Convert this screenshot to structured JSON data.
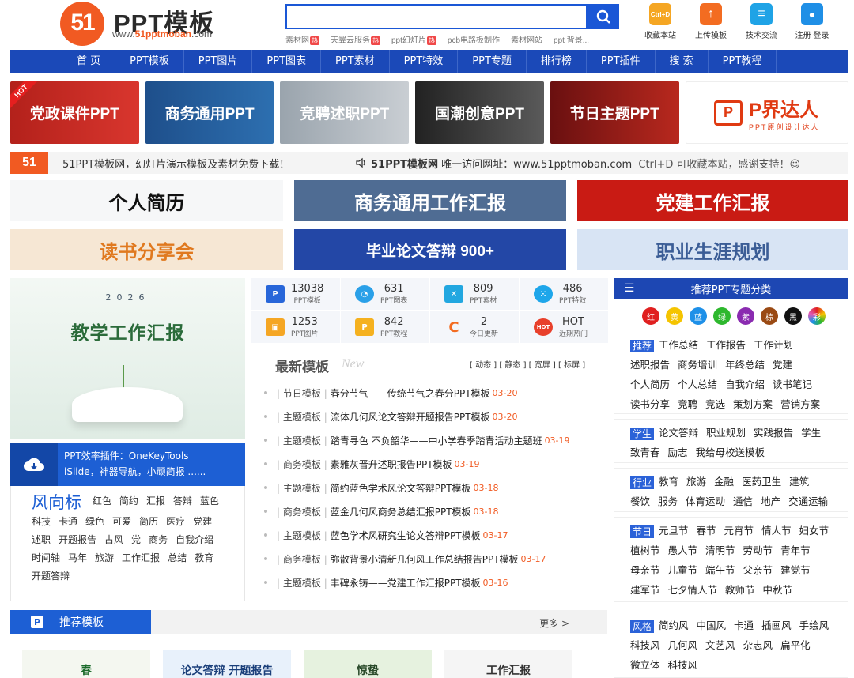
{
  "header": {
    "logo_mark": "51",
    "logo_title": "PPT模板",
    "logo_url_pre": "www.",
    "logo_url_mid": "51pptmoban",
    "logo_url_post": ".com",
    "search_placeholder": "",
    "hotwords": [
      "素材网",
      "天翼云服务",
      "ppt幻灯片",
      "pcb电路板制作",
      "素材网站",
      "ppt 背景..."
    ],
    "tools": [
      {
        "label": "收藏本站",
        "icon": "bookmark-icon",
        "color": "#f5a623",
        "glyph": "Ctrl+D"
      },
      {
        "label": "上传模板",
        "icon": "upload-icon",
        "color": "#f36c21",
        "glyph": "↑"
      },
      {
        "label": "技术交流",
        "icon": "chat-icon",
        "color": "#1fa3e6",
        "glyph": "≡"
      },
      {
        "label": "注册 登录",
        "icon": "user-icon",
        "color": "#1f8fe6",
        "glyph": "●"
      }
    ]
  },
  "nav": [
    "首 页",
    "PPT模板",
    "PPT图片",
    "PPT图表",
    "PPT素材",
    "PPT特效",
    "PPT专题",
    "排行榜",
    "PPT插件",
    "搜 索",
    "PPT教程"
  ],
  "banners": [
    "党政课件PPT",
    "商务通用PPT",
    "竞聘述职PPT",
    "国潮创意PPT",
    "节日主题PPT",
    "P界达人"
  ],
  "banner_hot": "HOT",
  "banner_sub": "PPT原创设计达人",
  "notice": {
    "mark": "51",
    "left": "51PPT模板网，幻灯片演示模板及素材免费下载！",
    "brand": "51PPT模板网",
    "right": "唯一访问网址：www.51pptmoban.com",
    "shortcut": "Ctrl+D 可收藏本站，感谢支持！☺"
  },
  "topics": [
    "个人简历",
    "商务通用工作汇报",
    "党建工作汇报",
    "读书分享会",
    "毕业论文答辩 900+",
    "职业生涯规划"
  ],
  "feature": {
    "year": "2026",
    "title": "教学工作汇报"
  },
  "plugin": {
    "line1": "PPT效率插件：OneKeyTools",
    "line2": "iSlide，神器导航，小顽简报 ......"
  },
  "trend": {
    "title": "风向标",
    "words": [
      "红色",
      "简约",
      "汇报",
      "答辩",
      "蓝色",
      "科技",
      "卡通",
      "绿色",
      "可爱",
      "简历",
      "医疗",
      "党建",
      "述职",
      "开题报告",
      "古风",
      "党",
      "商务",
      "自我介绍",
      "时间轴",
      "马年",
      "旅游",
      "工作汇报",
      "总结",
      "教育",
      "开题答辩"
    ]
  },
  "stats": [
    {
      "num": "13038",
      "label": "PPT模板",
      "icon": "ppt-template-icon",
      "color": "#2866d9",
      "glyph": "P"
    },
    {
      "num": "631",
      "label": "PPT图表",
      "icon": "pie-chart-icon",
      "color": "#2aa0e8",
      "glyph": "◔"
    },
    {
      "num": "809",
      "label": "PPT素材",
      "icon": "material-icon",
      "color": "#22a7e0",
      "glyph": "✕"
    },
    {
      "num": "486",
      "label": "PPT特效",
      "icon": "effect-icon",
      "color": "#1ea6ea",
      "glyph": "⁙"
    },
    {
      "num": "1253",
      "label": "PPT图片",
      "icon": "image-icon",
      "color": "#f5a623",
      "glyph": "▣"
    },
    {
      "num": "842",
      "label": "PPT教程",
      "icon": "tutorial-icon",
      "color": "#f5b11f",
      "glyph": "P"
    },
    {
      "num": "2",
      "label": "今日更新",
      "icon": "refresh-icon",
      "color": "#f36c21",
      "glyph": "C"
    },
    {
      "num": "HOT",
      "label": "近期热门",
      "icon": "hot-icon",
      "color": "#e8402b",
      "glyph": "HOT"
    }
  ],
  "latest": {
    "title": "最新模板",
    "subtitle": "New",
    "filters": "[ 动态 ] [ 静态 ] [ 宽屏 ] [ 标屏 ]",
    "items": [
      {
        "cat": "节日模板",
        "title": "春分节气——传统节气之春分PPT模板",
        "date": "03-20"
      },
      {
        "cat": "主题模板",
        "title": "流体几何风论文答辩开题报告PPT模板",
        "date": "03-20"
      },
      {
        "cat": "主题模板",
        "title": "踏青寻色 不负韶华——中小学春季踏青活动主题班",
        "date": "03-19"
      },
      {
        "cat": "商务模板",
        "title": "素雅灰晋升述职报告PPT模板",
        "date": "03-19"
      },
      {
        "cat": "主题模板",
        "title": "简约蓝色学术风论文答辩PPT模板",
        "date": "03-18"
      },
      {
        "cat": "商务模板",
        "title": "蓝金几何风商务总结汇报PPT模板",
        "date": "03-18"
      },
      {
        "cat": "主题模板",
        "title": "蓝色学术风研究生论文答辩PPT模板",
        "date": "03-17"
      },
      {
        "cat": "商务模板",
        "title": "弥散背景小清新几何风工作总结报告PPT模板",
        "date": "03-17"
      },
      {
        "cat": "主题模板",
        "title": "丰碑永铸——党建工作汇报PPT模板",
        "date": "03-16"
      }
    ]
  },
  "right": {
    "title": "推荐PPT专题分类",
    "colors": [
      {
        "label": "红",
        "color": "#e02020"
      },
      {
        "label": "黄",
        "color": "#f5c400"
      },
      {
        "label": "蓝",
        "color": "#1e90e8"
      },
      {
        "label": "绿",
        "color": "#2eb82e"
      },
      {
        "label": "紫",
        "color": "#8a2bb0"
      },
      {
        "label": "棕",
        "color": "#9a4a14"
      },
      {
        "label": "黑",
        "color": "#111111"
      },
      {
        "label": "彩",
        "color": "#e05ab8"
      }
    ],
    "groups": [
      {
        "tag": "推荐",
        "words": [
          "工作总结",
          "工作报告",
          "工作计划",
          "述职报告",
          "商务培训",
          "年终总结",
          "党建",
          "个人简历",
          "个人总结",
          "自我介绍",
          "读书笔记",
          "读书分享",
          "竞聘",
          "竞选",
          "策划方案",
          "营销方案"
        ]
      },
      {
        "tag": "学生",
        "words": [
          "论文答辩",
          "职业规划",
          "实践报告",
          "学生",
          "致青春",
          "励志",
          "我给母校送模板"
        ]
      },
      {
        "tag": "行业",
        "words": [
          "教育",
          "旅游",
          "金融",
          "医药卫生",
          "建筑",
          "餐饮",
          "服务",
          "体育运动",
          "通信",
          "地产",
          "交通运输"
        ]
      },
      {
        "tag": "节日",
        "words": [
          "元旦节",
          "春节",
          "元宵节",
          "情人节",
          "妇女节",
          "植树节",
          "愚人节",
          "清明节",
          "劳动节",
          "青年节",
          "母亲节",
          "儿童节",
          "端午节",
          "父亲节",
          "建党节",
          "建军节",
          "七夕情人节",
          "教师节",
          "中秋节"
        ]
      },
      {
        "tag": "风格",
        "words": [
          "简约风",
          "中国风",
          "卡通",
          "插画风",
          "手绘风",
          "科技风",
          "几何风",
          "文艺风",
          "杂志风",
          "扁平化",
          "微立体",
          "科技风"
        ]
      }
    ]
  },
  "recommend": {
    "title": "推荐模板",
    "more": "更多 >",
    "thumbs": [
      "春",
      "论文答辩 开题报告",
      "惊蛰",
      "工作汇报"
    ]
  }
}
